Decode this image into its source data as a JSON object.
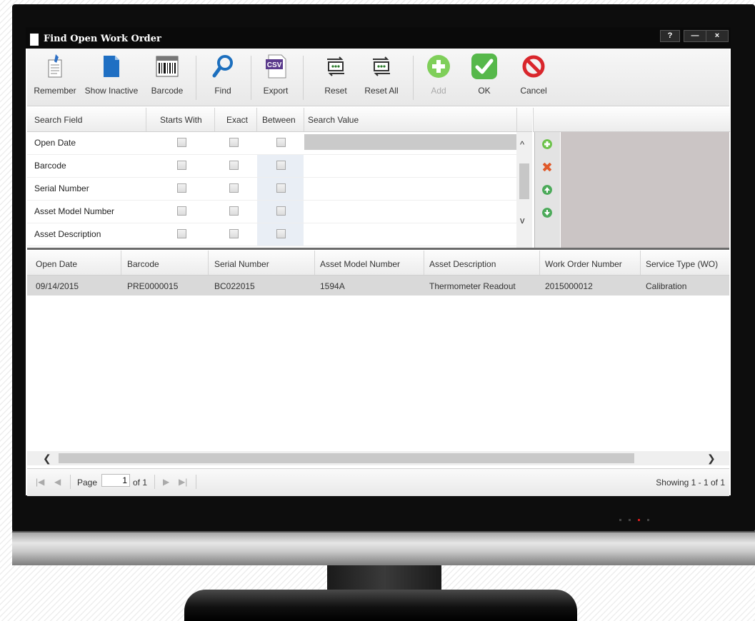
{
  "window": {
    "title": "Find Open Work Order",
    "help_label": "?",
    "minimize_label": "—",
    "close_label": "×"
  },
  "toolbar": {
    "remember": "Remember",
    "show_inactive": "Show Inactive",
    "barcode": "Barcode",
    "find": "Find",
    "export": "Export",
    "export_badge": "CSV",
    "reset": "Reset",
    "reset_all": "Reset All",
    "add": "Add",
    "ok": "OK",
    "cancel": "Cancel"
  },
  "search_grid": {
    "headers": [
      "Search Field",
      "Starts With",
      "Exact",
      "Between",
      "Search Value"
    ],
    "rows": [
      {
        "field": "Open Date"
      },
      {
        "field": "Barcode"
      },
      {
        "field": "Serial Number"
      },
      {
        "field": "Asset Model Number"
      },
      {
        "field": "Asset Description"
      }
    ],
    "scroll_up": "^",
    "scroll_down": "v"
  },
  "results": {
    "headers": [
      "Open Date",
      "Barcode",
      "Serial Number",
      "Asset Model Number",
      "Asset Description",
      "Work Order Number",
      "Service Type (WO)"
    ],
    "rows": [
      [
        "09/14/2015",
        "PRE0000015",
        "BC022015",
        "1594A",
        "Thermometer Readout",
        "2015000012",
        "Calibration"
      ]
    ]
  },
  "pager": {
    "page_label": "Page",
    "page_value": "1",
    "of_label": "of 1",
    "showing": "Showing 1 - 1 of 1"
  },
  "colors": {
    "add_green": "#6cc24a",
    "ok_green": "#5cb85c",
    "cancel_red": "#d9262c",
    "find_blue": "#1c6fbe",
    "delete_red": "#e05a2b"
  }
}
